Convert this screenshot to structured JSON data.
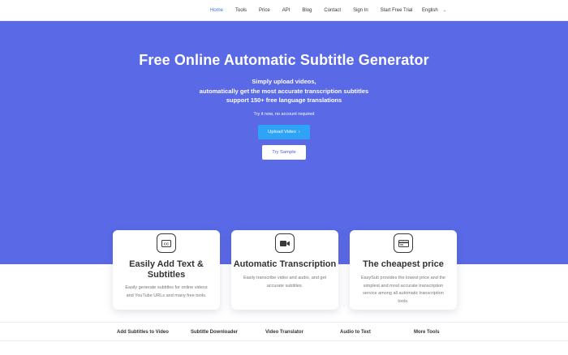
{
  "nav": {
    "items": [
      {
        "label": "Home",
        "active": true
      },
      {
        "label": "Tools"
      },
      {
        "label": "Price"
      },
      {
        "label": "API"
      },
      {
        "label": "Blog"
      },
      {
        "label": "Contact"
      },
      {
        "label": "Sign In"
      },
      {
        "label": "Start Free Trial"
      }
    ],
    "language": "English"
  },
  "hero": {
    "title": "Free Online Automatic Subtitle Generator",
    "subtitle_lines": [
      "Simply upload videos,",
      "automatically get the most accurate transcription subtitles",
      "support 150+ free language translations"
    ],
    "note": "Try it now, no account required",
    "upload_label": "Upload Video",
    "upload_arrow": "›",
    "sample_label": "Try Sample"
  },
  "cards": [
    {
      "icon": "cc-icon",
      "title_lines": [
        "Easily Add Text &",
        "Subtitles"
      ],
      "desc_lines": [
        "Easily generate subtitles for online videos",
        "and YouTube URLs and many free tools."
      ]
    },
    {
      "icon": "video-camera-icon",
      "title_lines": [
        "Automatic Transcription"
      ],
      "desc_lines": [
        "Easily transcribe video and audio, and get",
        "accurate subtitles."
      ]
    },
    {
      "icon": "card-icon",
      "title_lines": [
        "The cheapest price"
      ],
      "desc_lines": [
        "EasySub provides the lowest price and the",
        "simplest and most accurate transcription",
        "service among all automatic transcription",
        "tools."
      ]
    }
  ],
  "bottom_links": [
    "Add Subtitles to Video",
    "Subtitle Downloader",
    "Video Translator",
    "Audio to Text",
    "More Tools"
  ],
  "colors": {
    "hero_bg": "#5a69e6",
    "active_nav": "#3b6ee8",
    "upload_button": "#2fa3f5",
    "sample_text": "#4a5ee0"
  }
}
